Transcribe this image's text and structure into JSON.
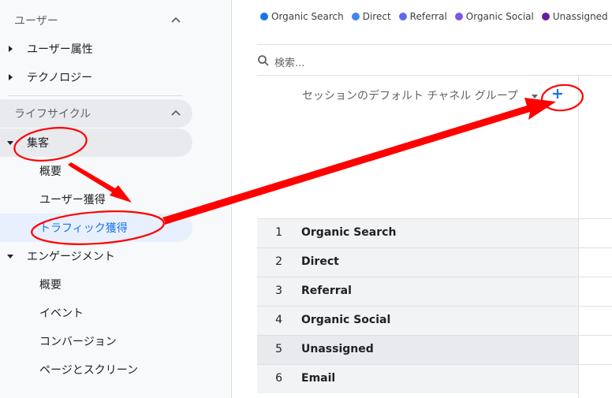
{
  "sidebar": {
    "users_section": {
      "label": "ユーザー",
      "items": [
        "ユーザー属性",
        "テクノロジー"
      ]
    },
    "lifecycle_section": {
      "label": "ライフサイクル"
    },
    "acquisition": {
      "label": "集客",
      "items": [
        "概要",
        "ユーザー獲得",
        "トラフィック獲得"
      ]
    },
    "engagement": {
      "label": "エンゲージメント",
      "items": [
        "概要",
        "イベント",
        "コンバージョン",
        "ページとスクリーン"
      ]
    }
  },
  "legend": [
    {
      "label": "Organic Search",
      "color": "#1a73e8"
    },
    {
      "label": "Direct",
      "color": "#4285f4"
    },
    {
      "label": "Referral",
      "color": "#5c6bf0"
    },
    {
      "label": "Organic Social",
      "color": "#7e57e8"
    },
    {
      "label": "Unassigned",
      "color": "#6a1b9a"
    }
  ],
  "search": {
    "placeholder": "検索..."
  },
  "table": {
    "column_header": "セッションのデフォルト チャネル グループ",
    "rows": [
      {
        "index": "1",
        "name": "Organic Search"
      },
      {
        "index": "2",
        "name": "Direct"
      },
      {
        "index": "3",
        "name": "Referral"
      },
      {
        "index": "4",
        "name": "Organic Social"
      },
      {
        "index": "5",
        "name": "Unassigned"
      },
      {
        "index": "6",
        "name": "Email"
      }
    ]
  },
  "colors": {
    "accent": "#1a73e8",
    "annotation": "#ff0000"
  }
}
